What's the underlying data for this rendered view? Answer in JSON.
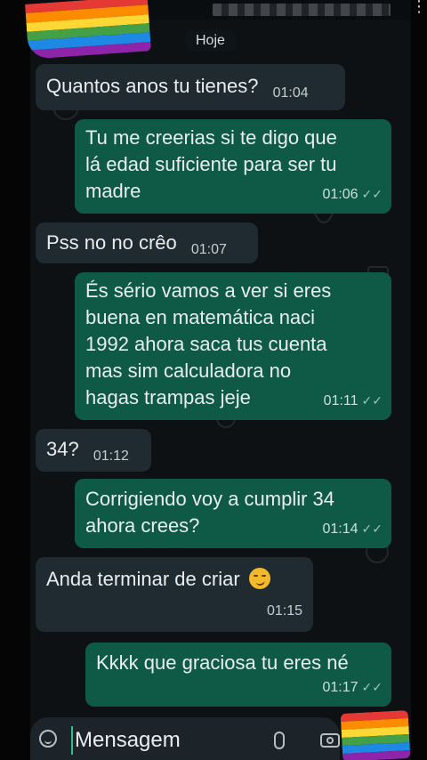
{
  "header": {
    "date_chip": "Hoje",
    "menu_icon": "kebab-menu-icon"
  },
  "messages": [
    {
      "dir": "in",
      "text": "Quantos anos tu tienes?",
      "time": "01:04"
    },
    {
      "dir": "out",
      "text": "Tu me creerias si te digo que\nlá edad suficiente para ser tu\nmadre",
      "time": "01:06"
    },
    {
      "dir": "in",
      "text": "Pss no no crêo",
      "time": "01:07"
    },
    {
      "dir": "out",
      "text": "És sério vamos a ver si eres\nbuena en matemática  naci\n1992 ahora saca tus  cuenta\nmas sim calculadora no\nhagas trampas  jeje",
      "time": "01:11"
    },
    {
      "dir": "in",
      "text": "34?",
      "time": "01:12"
    },
    {
      "dir": "out",
      "text": "Corrigiendo voy a cumplir 34\nahora  crees?",
      "time": "01:14"
    },
    {
      "dir": "in",
      "text": "Anda terminar de criar",
      "time": "01:15",
      "emoji": "smirking-face-emoji"
    },
    {
      "dir": "out",
      "text": "Kkkk que graciosa tu eres  né",
      "time": "01:17"
    }
  ],
  "read_ticks": "✓✓",
  "composer": {
    "placeholder": "Mensagem"
  },
  "colors": {
    "incoming": "#1f2b31",
    "outgoing": "#0f5a46",
    "background": "#0d1114"
  },
  "icons": [
    "emoji-icon",
    "attach-clip-icon",
    "camera-icon",
    "rainbow-flag-icon"
  ]
}
